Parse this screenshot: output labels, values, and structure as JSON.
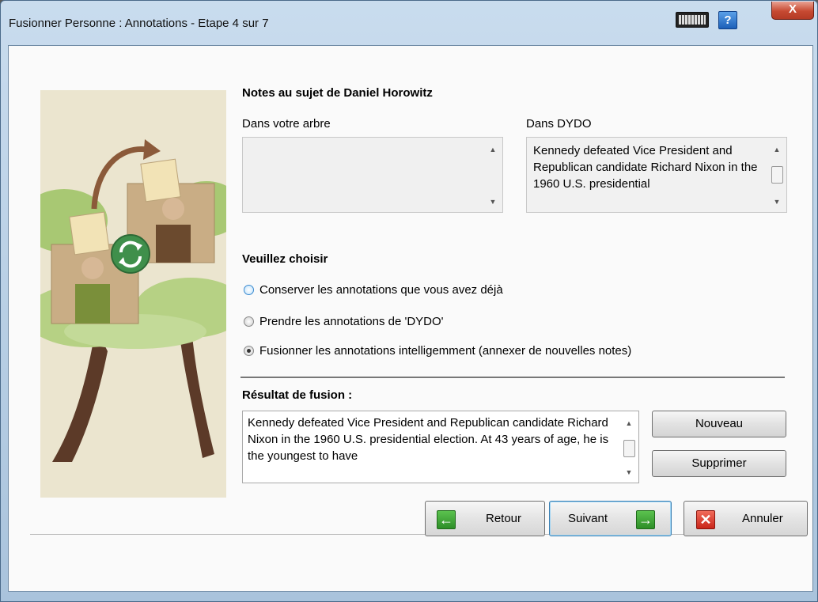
{
  "window": {
    "title": "Fusionner Personne : Annotations - Etape 4 sur 7",
    "help_label": "?",
    "close_label": "X"
  },
  "notes": {
    "heading": "Notes au sujet de Daniel Horowitz",
    "left_label": "Dans votre arbre",
    "left_text": "",
    "right_label": "Dans DYDO",
    "right_text": "Kennedy defeated Vice President and Republican candidate Richard Nixon in the 1960 U.S. presidential"
  },
  "choice": {
    "heading": "Veuillez choisir",
    "options": [
      {
        "label": "Conserver les annotations que vous avez déjà",
        "selected": false
      },
      {
        "label": "Prendre les annotations de 'DYDO'",
        "selected": false
      },
      {
        "label": "Fusionner les annotations intelligemment (annexer de nouvelles notes)",
        "selected": true
      }
    ]
  },
  "result": {
    "heading": "Résultat de fusion :",
    "text": "Kennedy defeated Vice President and Republican candidate Richard Nixon in the 1960 U.S. presidential election. At 43 years of age, he is the youngest to have",
    "new_label": "Nouveau",
    "delete_label": "Supprimer"
  },
  "nav": {
    "back_label": "Retour",
    "next_label": "Suivant",
    "cancel_label": "Annuler"
  },
  "icons": {
    "back": "arrow-left-icon",
    "next": "arrow-right-icon",
    "cancel": "x-icon",
    "sync": "sync-icon"
  },
  "colors": {
    "green": "#3aa333",
    "red": "#d8352a",
    "title_bar": "#bcd3ea"
  }
}
